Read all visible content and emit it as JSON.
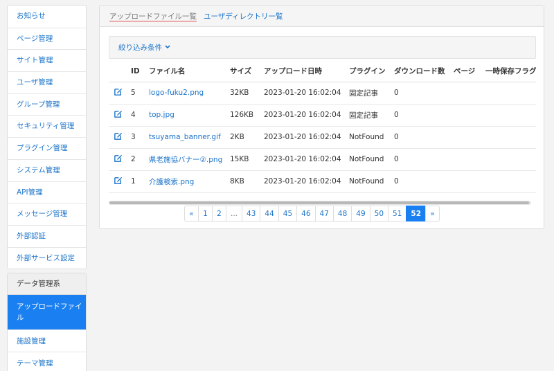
{
  "sidebar": {
    "items": [
      {
        "label": "お知らせ"
      },
      {
        "label": "ページ管理"
      },
      {
        "label": "サイト管理"
      },
      {
        "label": "ユーザ管理"
      },
      {
        "label": "グループ管理"
      },
      {
        "label": "セキュリティ管理"
      },
      {
        "label": "プラグイン管理"
      },
      {
        "label": "システム管理"
      },
      {
        "label": "API管理"
      },
      {
        "label": "メッセージ管理"
      },
      {
        "label": "外部認証"
      },
      {
        "label": "外部サービス設定"
      }
    ],
    "section_header": "データ管理系",
    "section_items": [
      {
        "label": "アップロードファイル"
      },
      {
        "label": "施設管理"
      },
      {
        "label": "テーマ管理"
      }
    ]
  },
  "tabs": {
    "active": "アップロードファイル一覧",
    "other": "ユーザディレクトリ一覧"
  },
  "filter": {
    "label": "絞り込み条件",
    "chevron_icon": "chevron-down-icon"
  },
  "table": {
    "headers": [
      "",
      "ID",
      "ファイル名",
      "サイズ",
      "アップロード日時",
      "プラグイン",
      "ダウンロード数",
      "ページ",
      "一時保存フラグ"
    ],
    "rows": [
      {
        "id": "5",
        "file": "logo-fuku2.png",
        "size": "32KB",
        "date": "2023-01-20 16:02:04",
        "plugin": "固定記事",
        "downloads": "0",
        "page": "",
        "temp": ""
      },
      {
        "id": "4",
        "file": "top.jpg",
        "size": "126KB",
        "date": "2023-01-20 16:02:04",
        "plugin": "固定記事",
        "downloads": "0",
        "page": "",
        "temp": ""
      },
      {
        "id": "3",
        "file": "tsuyama_banner.gif",
        "size": "2KB",
        "date": "2023-01-20 16:02:04",
        "plugin": "NotFound",
        "downloads": "0",
        "page": "",
        "temp": ""
      },
      {
        "id": "2",
        "file": "県老施協バナー②.png",
        "size": "15KB",
        "date": "2023-01-20 16:02:04",
        "plugin": "NotFound",
        "downloads": "0",
        "page": "",
        "temp": ""
      },
      {
        "id": "1",
        "file": "介護検索.png",
        "size": "8KB",
        "date": "2023-01-20 16:02:04",
        "plugin": "NotFound",
        "downloads": "0",
        "page": "",
        "temp": ""
      }
    ]
  },
  "pagination": {
    "prev": "«",
    "pages": [
      "1",
      "2",
      "...",
      "43",
      "44",
      "45",
      "46",
      "47",
      "48",
      "49",
      "50",
      "51",
      "52"
    ],
    "current": "52",
    "next": "»"
  },
  "colors": {
    "accent": "#1a7ff1",
    "link": "#1a73c9",
    "tab_underline": "#d9534f"
  }
}
